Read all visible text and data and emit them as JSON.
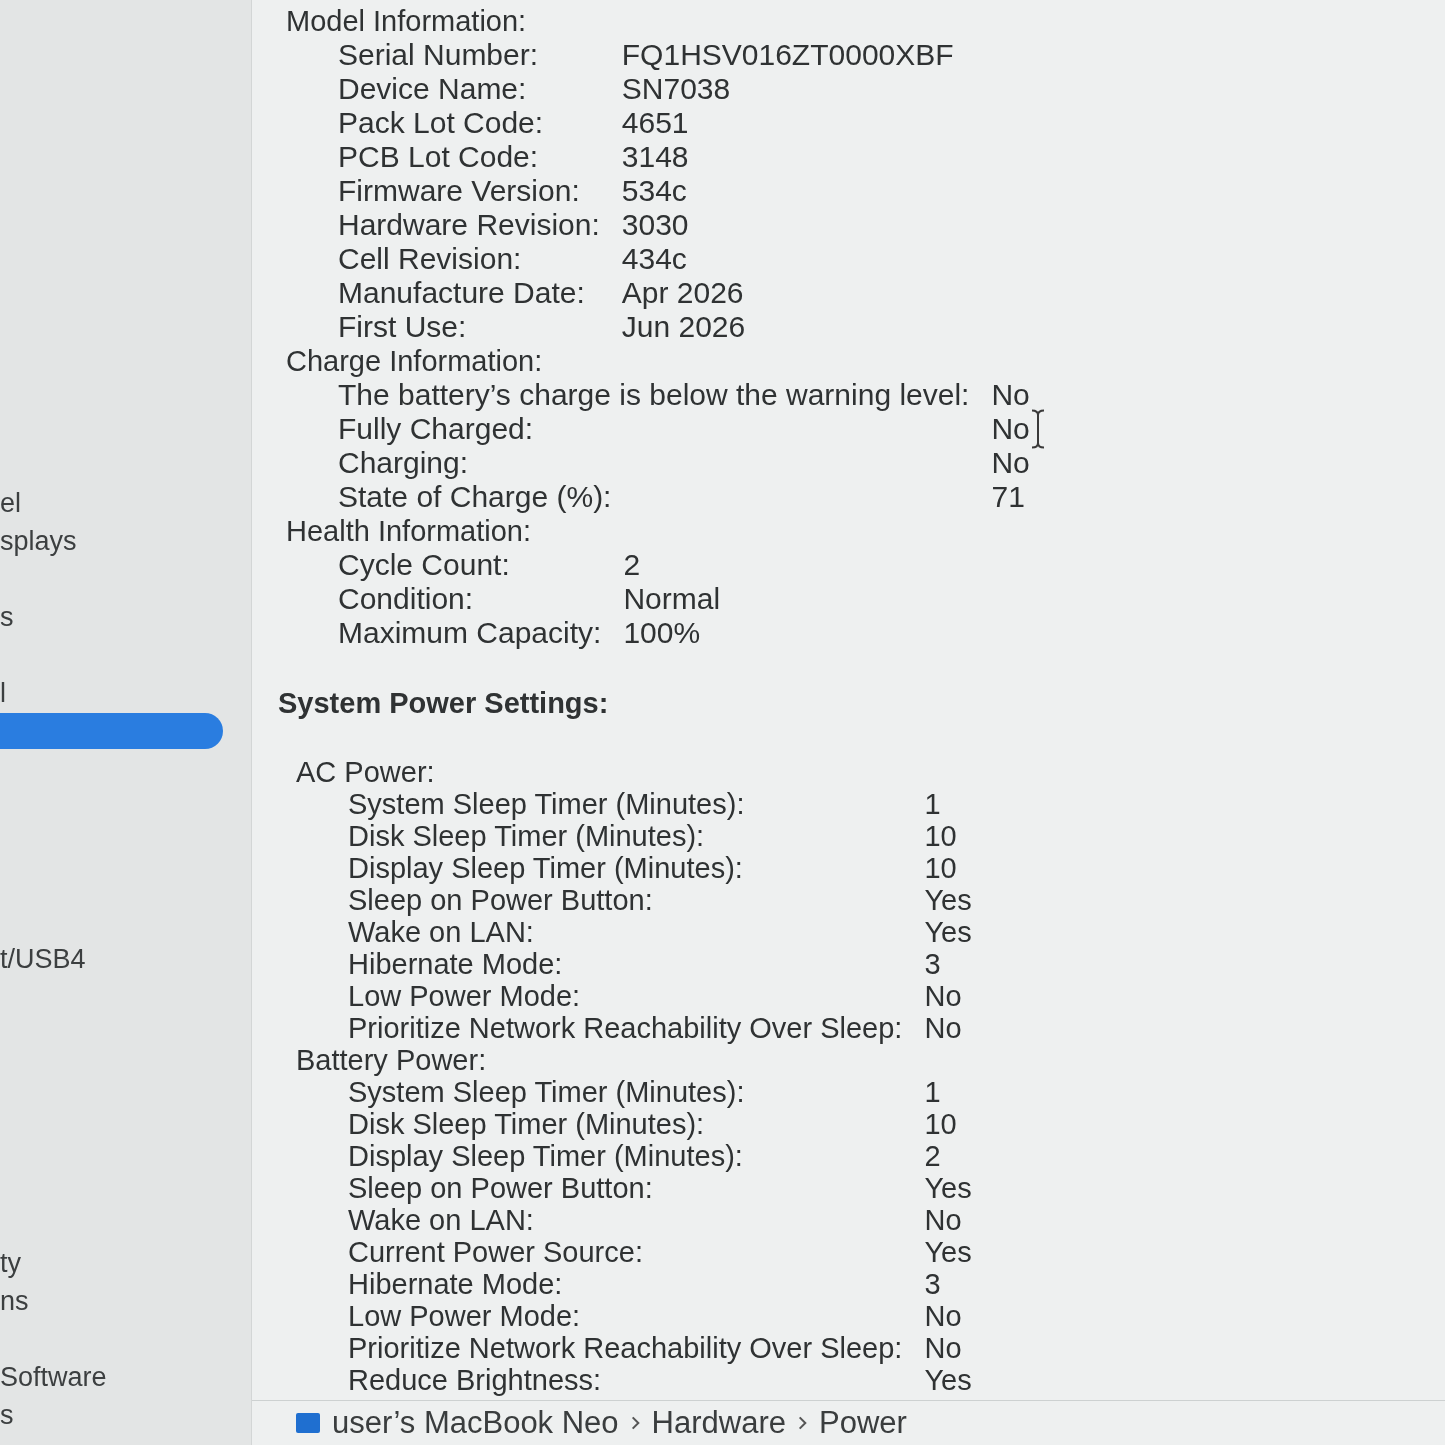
{
  "sidebar": {
    "items": [
      {
        "label": "el",
        "selected": false
      },
      {
        "label": "splays",
        "selected": false
      },
      {
        "label": "s",
        "selected": false
      },
      {
        "label": "l",
        "selected": false
      },
      {
        "selected": true
      },
      {
        "label": "t/USB4",
        "selected": false
      },
      {
        "label": "ty",
        "selected": false
      },
      {
        "label": "ns",
        "selected": false
      },
      {
        "label": "Software",
        "selected": false
      },
      {
        "label": "s",
        "selected": false
      }
    ]
  },
  "battery_information": {
    "sections": [
      {
        "title": "Model Information:",
        "rows": [
          {
            "label": "Serial Number:",
            "value": "FQ1HSV016ZT0000XBF"
          },
          {
            "label": "Device Name:",
            "value": "SN7038"
          },
          {
            "label": "Pack Lot Code:",
            "value": "4651"
          },
          {
            "label": "PCB Lot Code:",
            "value": "3148"
          },
          {
            "label": "Firmware Version:",
            "value": "534c"
          },
          {
            "label": "Hardware Revision:",
            "value": "3030"
          },
          {
            "label": "Cell Revision:",
            "value": "434c"
          },
          {
            "label": "Manufacture Date:",
            "value": "Apr 2026"
          },
          {
            "label": "First Use:",
            "value": "Jun 2026"
          }
        ]
      },
      {
        "title": "Charge Information:",
        "rows": [
          {
            "label": "The battery’s charge is below the warning level:",
            "value": "No"
          },
          {
            "label": "Fully Charged:",
            "value": "No",
            "text_cursor": true
          },
          {
            "label": "Charging:",
            "value": "No"
          },
          {
            "label": "State of Charge (%):",
            "value": "71"
          }
        ]
      },
      {
        "title": "Health Information:",
        "rows": [
          {
            "label": "Cycle Count:",
            "value": "2"
          },
          {
            "label": "Condition:",
            "value": "Normal"
          },
          {
            "label": "Maximum Capacity:",
            "value": "100%"
          }
        ]
      }
    ]
  },
  "system_power_settings": {
    "title": "System Power Settings:",
    "sections": [
      {
        "title": "AC Power:",
        "rows": [
          {
            "label": "System Sleep Timer (Minutes):",
            "value": "1"
          },
          {
            "label": "Disk Sleep Timer (Minutes):",
            "value": "10"
          },
          {
            "label": "Display Sleep Timer (Minutes):",
            "value": "10"
          },
          {
            "label": "Sleep on Power Button:",
            "value": "Yes"
          },
          {
            "label": "Wake on LAN:",
            "value": "Yes"
          },
          {
            "label": "Hibernate Mode:",
            "value": "3"
          },
          {
            "label": "Low Power Mode:",
            "value": "No"
          },
          {
            "label": "Prioritize Network Reachability Over Sleep:",
            "value": "No"
          }
        ]
      },
      {
        "title": "Battery Power:",
        "rows": [
          {
            "label": "System Sleep Timer (Minutes):",
            "value": "1"
          },
          {
            "label": "Disk Sleep Timer (Minutes):",
            "value": "10"
          },
          {
            "label": "Display Sleep Timer (Minutes):",
            "value": "2"
          },
          {
            "label": "Sleep on Power Button:",
            "value": "Yes"
          },
          {
            "label": "Wake on LAN:",
            "value": "No"
          },
          {
            "label": "Current Power Source:",
            "value": "Yes"
          },
          {
            "label": "Hibernate Mode:",
            "value": "3"
          },
          {
            "label": "Low Power Mode:",
            "value": "No"
          },
          {
            "label": "Prioritize Network Reachability Over Sleep:",
            "value": "No"
          },
          {
            "label": "Reduce Brightness:",
            "value": "Yes"
          }
        ]
      }
    ]
  },
  "path_bar": {
    "items": [
      "user’s MacBook Neo",
      "Hardware",
      "Power"
    ]
  }
}
